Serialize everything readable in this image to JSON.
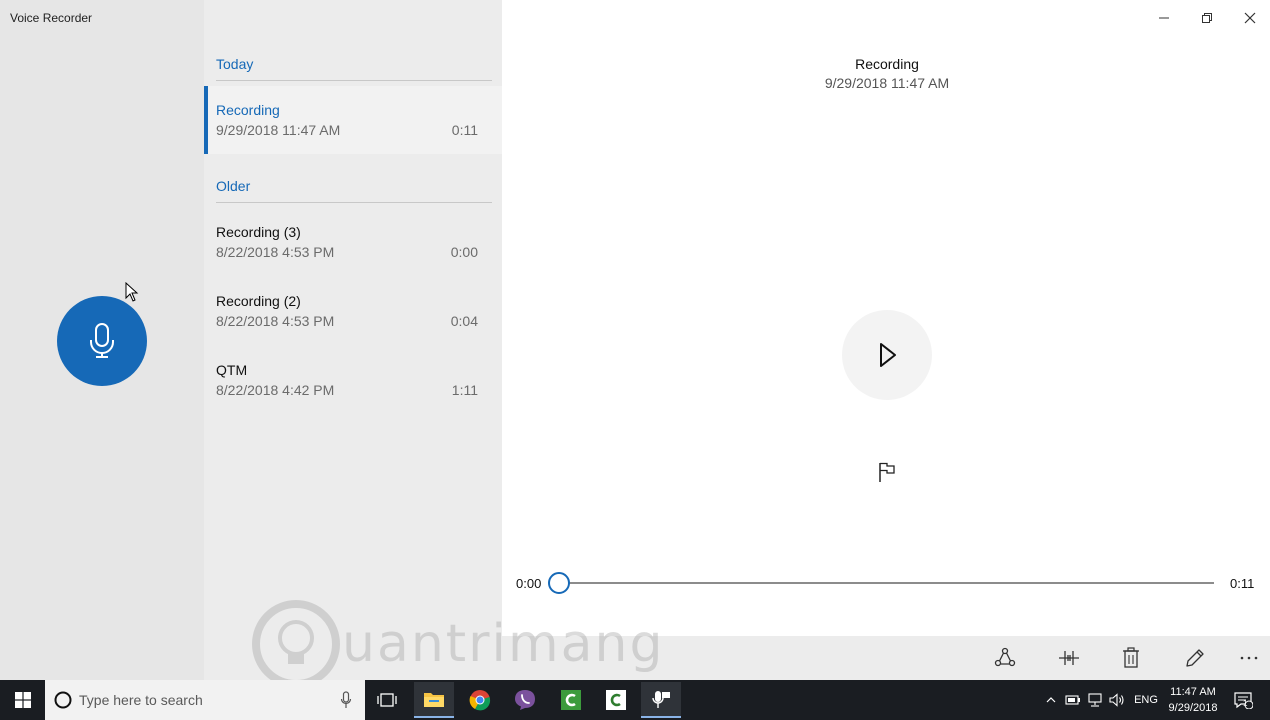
{
  "app": {
    "title": "Voice Recorder"
  },
  "list": {
    "groups": [
      {
        "header": "Today"
      },
      {
        "header": "Older"
      }
    ],
    "items": [
      {
        "name": "Recording",
        "date": "9/29/2018 11:47 AM",
        "duration": "0:11"
      },
      {
        "name": "Recording (3)",
        "date": "8/22/2018 4:53 PM",
        "duration": "0:00"
      },
      {
        "name": "Recording (2)",
        "date": "8/22/2018 4:53 PM",
        "duration": "0:04"
      },
      {
        "name": "QTM",
        "date": "8/22/2018 4:42 PM",
        "duration": "1:11"
      }
    ]
  },
  "player": {
    "title": "Recording",
    "date": "9/29/2018 11:47 AM",
    "current_time": "0:00",
    "total_time": "0:11",
    "progress": 0
  },
  "watermark": {
    "text": "uantrimang"
  },
  "taskbar": {
    "search_placeholder": "Type here to search",
    "language": "ENG",
    "time": "11:47 AM",
    "date": "9/29/2018",
    "notification_count": "1"
  },
  "colors": {
    "accent": "#1669b7",
    "taskbar": "#1a1d22"
  }
}
